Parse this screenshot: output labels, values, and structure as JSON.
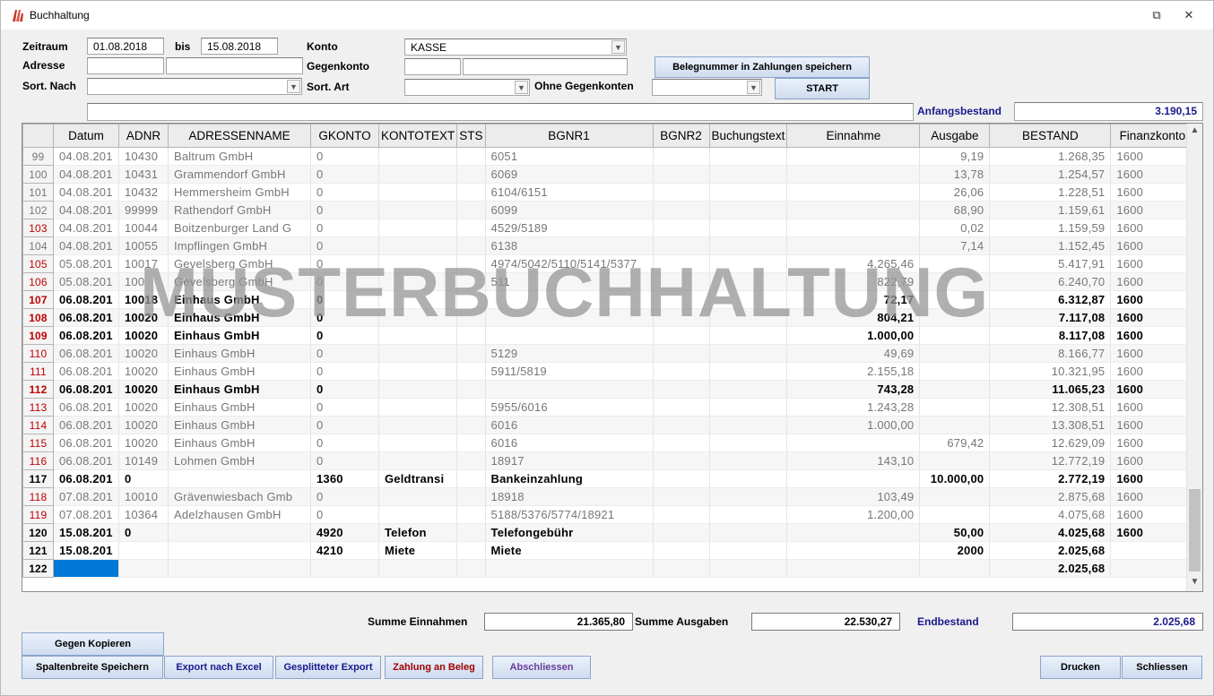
{
  "window": {
    "title": "Buchhaltung",
    "minimize_glyph": "⧉",
    "close_glyph": "✕"
  },
  "filters": {
    "zeitraum_label": "Zeitraum",
    "date_from": "01.08.2018",
    "bis_label": "bis",
    "date_to": "15.08.2018",
    "adresse_label": "Adresse",
    "adresse_nr": "",
    "adresse_name": "",
    "sort_nach_label": "Sort. Nach",
    "sort_nach_value": "",
    "konto_label": "Konto",
    "konto_value": "KASSE",
    "gegenkonto_label": "Gegenkonto",
    "gegenkonto_nr": "",
    "gegenkonto_name": "",
    "sort_art_label": "Sort. Art",
    "sort_art_value": "",
    "ohne_gegenkonten_label": "Ohne Gegenkonten",
    "ohne_gegenkonten_value": "",
    "belegnummer_button": "Belegnummer in Zahlungen speichern",
    "start_button": "START",
    "info_field": "",
    "anfangsbestand_label": "Anfangsbestand",
    "anfangsbestand_value": "3.190,15"
  },
  "grid": {
    "columns": [
      "Datum",
      "ADNR",
      "ADRESSENNAME",
      "GKONTO",
      "KONTOTEXT",
      "STS",
      "BGNR1",
      "BGNR2",
      "Buchungstext",
      "Einnahme",
      "Ausgabe",
      "BESTAND",
      "Finanzkonto"
    ],
    "rows": [
      {
        "n": "99",
        "style": "grey",
        "cells": [
          "04.08.201",
          "10430",
          "Baltrum GmbH",
          "0",
          "",
          "",
          "6051",
          "",
          "",
          "",
          "9,19",
          "1.268,35",
          "1600"
        ]
      },
      {
        "n": "100",
        "style": "grey",
        "cells": [
          "04.08.201",
          "10431",
          "Grammendorf GmbH",
          "0",
          "",
          "",
          "6069",
          "",
          "",
          "",
          "13,78",
          "1.254,57",
          "1600"
        ]
      },
      {
        "n": "101",
        "style": "grey",
        "cells": [
          "04.08.201",
          "10432",
          "Hemmersheim GmbH",
          "0",
          "",
          "",
          "6104/6151",
          "",
          "",
          "",
          "26,06",
          "1.228,51",
          "1600"
        ]
      },
      {
        "n": "102",
        "style": "grey",
        "cells": [
          "04.08.201",
          "99999",
          "Rathendorf GmbH",
          "0",
          "",
          "",
          "6099",
          "",
          "",
          "",
          "68,90",
          "1.159,61",
          "1600"
        ]
      },
      {
        "n": "103",
        "style": "grey",
        "cells": [
          "04.08.201",
          "10044",
          "Boitzenburger Land G",
          "0",
          "",
          "",
          "4529/5189",
          "",
          "",
          "",
          "0,02",
          "1.159,59",
          "1600"
        ]
      },
      {
        "n": "104",
        "style": "grey",
        "cells": [
          "04.08.201",
          "10055",
          "Impflingen GmbH",
          "0",
          "",
          "",
          "6138",
          "",
          "",
          "",
          "7,14",
          "1.152,45",
          "1600"
        ]
      },
      {
        "n": "105",
        "style": "grey",
        "cells": [
          "05.08.201",
          "10017",
          "Gevelsberg GmbH",
          "0",
          "",
          "",
          "4974/5042/5110/5141/5377",
          "",
          "",
          "4.265,46",
          "",
          "5.417,91",
          "1600"
        ]
      },
      {
        "n": "106",
        "style": "grey",
        "cells": [
          "05.08.201",
          "100",
          "Gevelsberg GmbH",
          "0",
          "",
          "",
          "511",
          "",
          "",
          "822,79",
          "",
          "6.240,70",
          "1600"
        ]
      },
      {
        "n": "107",
        "style": "bold",
        "cells": [
          "06.08.201",
          "10018",
          "Einhaus GmbH",
          "0",
          "",
          "",
          "",
          "",
          "",
          "72,17",
          "",
          "6.312,87",
          "1600"
        ]
      },
      {
        "n": "108",
        "style": "bold",
        "cells": [
          "06.08.201",
          "10020",
          "Einhaus GmbH",
          "0",
          "",
          "",
          "",
          "",
          "",
          "804,21",
          "",
          "7.117,08",
          "1600"
        ]
      },
      {
        "n": "109",
        "style": "bold",
        "cells": [
          "06.08.201",
          "10020",
          "Einhaus GmbH",
          "0",
          "",
          "",
          "",
          "",
          "",
          "1.000,00",
          "",
          "8.117,08",
          "1600"
        ]
      },
      {
        "n": "110",
        "style": "grey",
        "cells": [
          "06.08.201",
          "10020",
          "Einhaus GmbH",
          "0",
          "",
          "",
          "5129",
          "",
          "",
          "49,69",
          "",
          "8.166,77",
          "1600"
        ]
      },
      {
        "n": "111",
        "style": "grey",
        "cells": [
          "06.08.201",
          "10020",
          "Einhaus GmbH",
          "0",
          "",
          "",
          "5911/5819",
          "",
          "",
          "2.155,18",
          "",
          "10.321,95",
          "1600"
        ]
      },
      {
        "n": "112",
        "style": "bold",
        "cells": [
          "06.08.201",
          "10020",
          "Einhaus GmbH",
          "0",
          "",
          "",
          "",
          "",
          "",
          "743,28",
          "",
          "11.065,23",
          "1600"
        ]
      },
      {
        "n": "113",
        "style": "grey",
        "cells": [
          "06.08.201",
          "10020",
          "Einhaus GmbH",
          "0",
          "",
          "",
          "5955/6016",
          "",
          "",
          "1.243,28",
          "",
          "12.308,51",
          "1600"
        ]
      },
      {
        "n": "114",
        "style": "grey",
        "cells": [
          "06.08.201",
          "10020",
          "Einhaus GmbH",
          "0",
          "",
          "",
          "6016",
          "",
          "",
          "1.000,00",
          "",
          "13.308,51",
          "1600"
        ]
      },
      {
        "n": "115",
        "style": "grey",
        "cells": [
          "06.08.201",
          "10020",
          "Einhaus GmbH",
          "0",
          "",
          "",
          "6016",
          "",
          "",
          "",
          "679,42",
          "12.629,09",
          "1600"
        ]
      },
      {
        "n": "116",
        "style": "grey",
        "cells": [
          "06.08.201",
          "10149",
          "Lohmen GmbH",
          "0",
          "",
          "",
          "18917",
          "",
          "",
          "143,10",
          "",
          "12.772,19",
          "1600"
        ]
      },
      {
        "n": "117",
        "style": "bold",
        "cells": [
          "06.08.201",
          "0",
          "",
          "1360",
          "Geldtransi",
          "",
          "Bankeinzahlung",
          "",
          "",
          "",
          "10.000,00",
          "2.772,19",
          "1600"
        ]
      },
      {
        "n": "118",
        "style": "grey",
        "cells": [
          "07.08.201",
          "10010",
          "Grävenwiesbach Gmb",
          "0",
          "",
          "",
          "18918",
          "",
          "",
          "103,49",
          "",
          "2.875,68",
          "1600"
        ]
      },
      {
        "n": "119",
        "style": "grey",
        "cells": [
          "07.08.201",
          "10364",
          "Adelzhausen GmbH",
          "0",
          "",
          "",
          "5188/5376/5774/18921",
          "",
          "",
          "1.200,00",
          "",
          "4.075,68",
          "1600"
        ]
      },
      {
        "n": "120",
        "style": "bold",
        "cells": [
          "15.08.201",
          "0",
          "",
          "4920",
          "Telefon",
          "",
          "Telefongebühr",
          "",
          "",
          "",
          "50,00",
          "4.025,68",
          "1600"
        ]
      },
      {
        "n": "121",
        "style": "bold",
        "cells": [
          "15.08.201",
          "",
          "",
          "4210",
          "Miete",
          "",
          "Miete",
          "",
          "",
          "",
          "2000",
          "2.025,68",
          ""
        ]
      },
      {
        "n": "122",
        "style": "bold",
        "cells": [
          "",
          "",
          "",
          "",
          "",
          "",
          "",
          "",
          "",
          "",
          "",
          "2.025,68",
          ""
        ]
      }
    ],
    "red_numbers": [
      "103",
      "105",
      "106",
      "107",
      "108",
      "109",
      "110",
      "111",
      "112",
      "113",
      "114",
      "115",
      "116",
      "118",
      "119"
    ]
  },
  "watermark": "MUSTERBUCHHALTUNG",
  "summary": {
    "summe_einnahmen_label": "Summe Einnahmen",
    "summe_einnahmen_value": "21.365,80",
    "summe_ausgaben_label": "Summe Ausgaben",
    "summe_ausgaben_value": "22.530,27",
    "endbestand_label": "Endbestand",
    "endbestand_value": "2.025,68"
  },
  "buttons": {
    "gegen_kopieren": "Gegen Kopieren",
    "spaltenbreite": "Spaltenbreite Speichern",
    "export_excel": "Export nach Excel",
    "gesplittet": "Gesplitteter Export",
    "zahlung_beleg": "Zahlung an Beleg",
    "abschliessen": "Abschliessen",
    "drucken": "Drucken",
    "schliessen": "Schliessen"
  },
  "colors": {
    "accent_blue": "#1a1a8c",
    "red_text": "#a00000",
    "purple_text": "#6a3d9a",
    "selection": "#0078d7"
  }
}
